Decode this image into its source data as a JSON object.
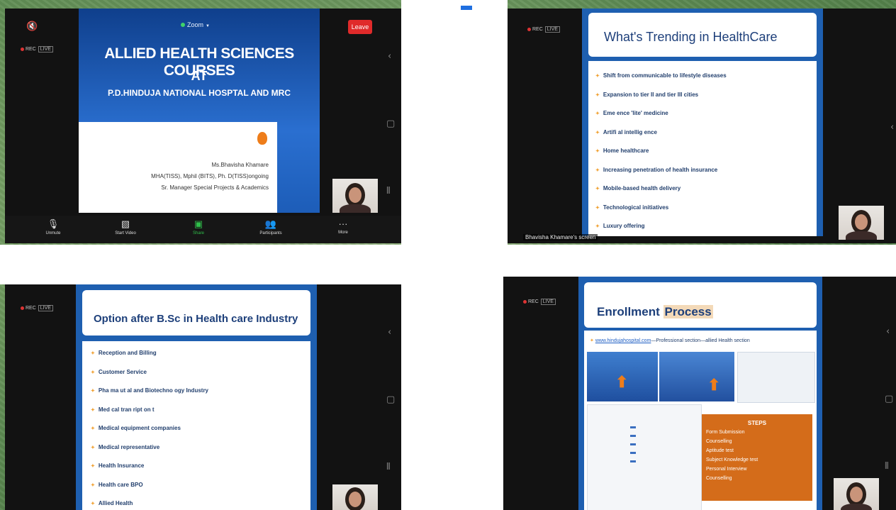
{
  "panels": {
    "top_left": {
      "zoom_label": "Zoom",
      "leave_label": "Leave",
      "rec_label": "REC",
      "live_label": "LIVE",
      "slide_title_line1": "ALLIED HEALTH SCIENCES COURSES",
      "slide_title_line2": "AT",
      "slide_title_line3": "P.D.HINDUJA NATIONAL HOSPTAL AND MRC",
      "presenter_name": "Ms.Bhavisha Khamare",
      "presenter_quals": "MHA(TISS), Mphil (BITS), Ph. D(TISS)ongoing",
      "presenter_role": "Sr. Manager Special Projects & Academics",
      "toolbar": {
        "unmute": "Unmute",
        "start_video": "Start Video",
        "share": "Share",
        "participants": "Participants",
        "more": "More"
      }
    },
    "top_right": {
      "rec_label": "REC",
      "live_label": "LIVE",
      "slide_title": "What's Trending in HealthCare",
      "bullets": [
        "Shift from communicable to lifestyle diseases",
        "Expansion to tier II and tier III cities",
        "Eme  ence  'lite'  medicine",
        "Artifi  al intellig  ence",
        "Home healthcare",
        "Increasing penetration of health insurance",
        "Mobile-based health delivery",
        "Technological initiatives",
        "Luxury offering"
      ],
      "screen_label": "Bhavisha Khamare's screen"
    },
    "bottom_left": {
      "rec_label": "REC",
      "live_label": "LIVE",
      "slide_title": "Option after B.Sc in Health care Industry",
      "bullets": [
        "Reception and Billing",
        "Customer Service",
        "Pha  ma  ut  al and Biotechno  ogy Industry",
        "Med  cal tran  ript  on  t",
        "Medical equipment companies",
        "Medical representative",
        "Health  Insurance",
        "Health care BPO",
        "Allied Health"
      ]
    },
    "bottom_right": {
      "rec_label": "REC",
      "live_label": "LIVE",
      "slide_title_part1": "Enrollment",
      "slide_title_part2": "Process",
      "link_line_url": "www.hindujahospital.com",
      "link_line_rest": "—Professional section—allied Health section",
      "steps_title": "STEPS",
      "steps": [
        "Form Submission",
        "Counselling",
        "Aptitude test",
        "Subject Knowledge test",
        "Personal Interview",
        "Counselling"
      ]
    }
  },
  "colors": {
    "slide_blue": "#1e5fb0",
    "title_navy": "#1d3f7a",
    "bullet_orange": "#f0a030",
    "steps_orange": "#d46c1a",
    "leave_red": "#e02a2a",
    "share_green": "#2fbf4a"
  }
}
